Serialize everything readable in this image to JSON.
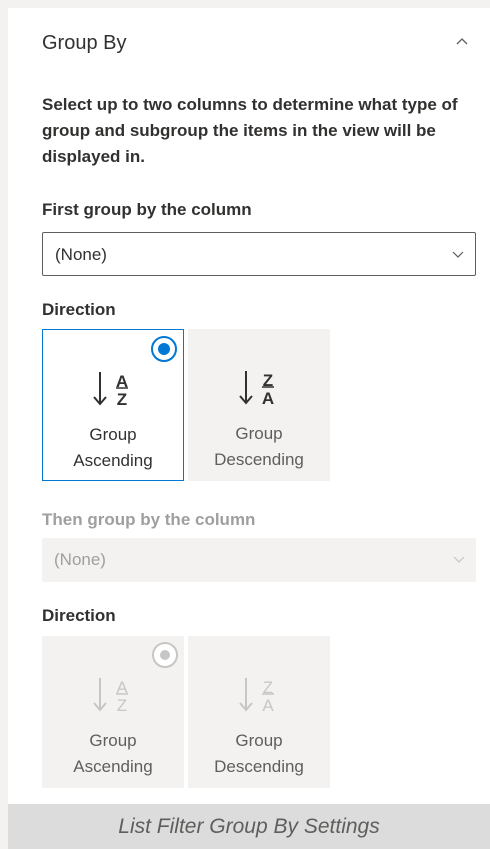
{
  "header": {
    "title": "Group By"
  },
  "description": "Select up to two columns to determine what type of group and subgroup the items in the view will be displayed in.",
  "first_group": {
    "label": "First group by the column",
    "value": "(None)",
    "direction_label": "Direction",
    "options": [
      {
        "line1": "Group",
        "line2": "Ascending",
        "icon": "sort-ascending-icon",
        "selected": true
      },
      {
        "line1": "Group",
        "line2": "Descending",
        "icon": "sort-descending-icon",
        "selected": false
      }
    ]
  },
  "second_group": {
    "label": "Then group by the column",
    "value": "(None)",
    "direction_label": "Direction",
    "disabled": true,
    "options": [
      {
        "line1": "Group",
        "line2": "Ascending",
        "icon": "sort-ascending-icon",
        "selected": true
      },
      {
        "line1": "Group",
        "line2": "Descending",
        "icon": "sort-descending-icon",
        "selected": false
      }
    ]
  },
  "caption": "List Filter Group By Settings",
  "colors": {
    "accent": "#0078d4",
    "text": "#323130",
    "disabled_text": "#a19f9d",
    "tile_background": "#f3f2f1"
  }
}
